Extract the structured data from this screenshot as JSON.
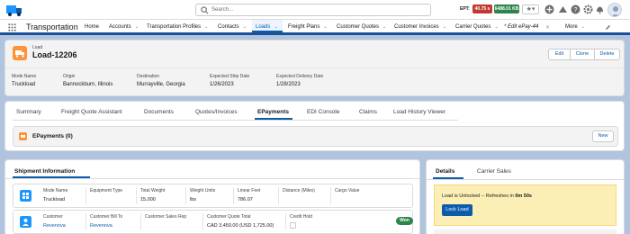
{
  "header": {
    "search_placeholder": "Search...",
    "ept_label": "EPT:",
    "badge_red": "40.75 s",
    "badge_green": "6488.01 KB"
  },
  "nav": {
    "app_name": "Transportation",
    "items": [
      {
        "label": "Home",
        "chevron": false
      },
      {
        "label": "Accounts",
        "chevron": true
      },
      {
        "label": "Transportation Profiles",
        "chevron": true
      },
      {
        "label": "Contacts",
        "chevron": true
      },
      {
        "label": "Loads",
        "chevron": true
      },
      {
        "label": "Freight Plans",
        "chevron": true
      },
      {
        "label": "Customer Quotes",
        "chevron": true
      },
      {
        "label": "Customer Invoices",
        "chevron": true
      },
      {
        "label": "Carrier Quotes",
        "chevron": true
      },
      {
        "label": "* Edit ePay-44",
        "chevron": false
      },
      {
        "label": "More",
        "chevron": true
      }
    ]
  },
  "record": {
    "object_label": "Load",
    "title": "Load-12206",
    "buttons": {
      "edit": "Edit",
      "clone": "Clone",
      "delete": "Delete"
    },
    "fields": [
      {
        "label": "Mode Name",
        "value": "Truckload"
      },
      {
        "label": "Origin",
        "value": "Bannockburn, Illinois"
      },
      {
        "label": "Destination",
        "value": "Murrayville, Georgia"
      },
      {
        "label": "Expected Ship Date",
        "value": "1/26/2023"
      },
      {
        "label": "Expected Delivery Date",
        "value": "1/28/2023"
      }
    ]
  },
  "tabs": [
    {
      "label": "Summary"
    },
    {
      "label": "Freight Quote Assistant"
    },
    {
      "label": "Documents"
    },
    {
      "label": "Quotes/Invoices"
    },
    {
      "label": "EPayments"
    },
    {
      "label": "EDI Console"
    },
    {
      "label": "Claims"
    },
    {
      "label": "Load History Viewer"
    }
  ],
  "epayments": {
    "title": "EPayments (0)",
    "new_button": "New"
  },
  "shipment": {
    "title": "Shipment Information",
    "row1": [
      {
        "label": "Mode Name",
        "value": "Truckload"
      },
      {
        "label": "Equipment Type",
        "value": ""
      },
      {
        "label": "Total Weight",
        "value": "15,000"
      },
      {
        "label": "Weight Units",
        "value": "lbs"
      },
      {
        "label": "Linear Feet",
        "value": "786.07"
      },
      {
        "label": "Distance (Miles)",
        "value": ""
      },
      {
        "label": "Cargo Value",
        "value": ""
      }
    ],
    "row2": [
      {
        "label": "Customer",
        "value": "Revenova"
      },
      {
        "label": "Customer Bill To",
        "value": "Revenova"
      },
      {
        "label": "Customer Sales Rep",
        "value": ""
      },
      {
        "label": "Customer Quote Total",
        "value": "CAD 3,450.00 (USD 1,725.00)"
      },
      {
        "label": "Credit Hold",
        "value": ""
      }
    ],
    "won_badge": "Won"
  },
  "details": {
    "tab_details": "Details",
    "tab_carrier_sales": "Carrier Sales",
    "lock_message_prefix": "Load is Unlocked -- Refreshes in ",
    "lock_countdown": "0m 50s",
    "lock_button": "Lock Load"
  },
  "colors": {
    "brand_blue": "#0b5cab",
    "nav_underline": "#1b5297",
    "record_icon": "#fe9339",
    "badge_red": "#c23934",
    "badge_green": "#2e844a",
    "warning_panel": "#fcefb6",
    "background": "#b0c4df"
  }
}
